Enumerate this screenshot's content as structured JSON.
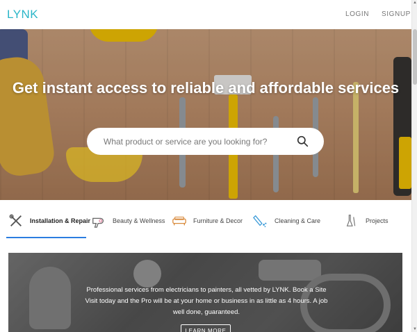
{
  "header": {
    "logo": "LYNK",
    "login_label": "LOGIN",
    "signup_label": "SIGNUP"
  },
  "hero": {
    "title": "Get instant access to reliable and affordable services",
    "search": {
      "placeholder": "What product or service are you looking for?",
      "value": ""
    }
  },
  "categories": [
    {
      "label": "Installation & Repair",
      "icon": "tools-icon",
      "active": true
    },
    {
      "label": "Beauty & Wellness",
      "icon": "hair-dryer-icon",
      "active": false
    },
    {
      "label": "Furniture & Decor",
      "icon": "sofa-icon",
      "active": false
    },
    {
      "label": "Cleaning & Care",
      "icon": "spray-bottle-icon",
      "active": false
    },
    {
      "label": "Projects",
      "icon": "paint-brushes-icon",
      "active": false
    }
  ],
  "banner": {
    "text": "Professional services from electricians to painters, all vetted by LYNK. Book a Site Visit today and the Pro will be at your home or business in as little as 4 hours. A job well done, guaranteed.",
    "button_label": "LEARN MORE"
  },
  "colors": {
    "brand": "#2bb6c8",
    "active_tab_underline": "#2b7de0"
  }
}
